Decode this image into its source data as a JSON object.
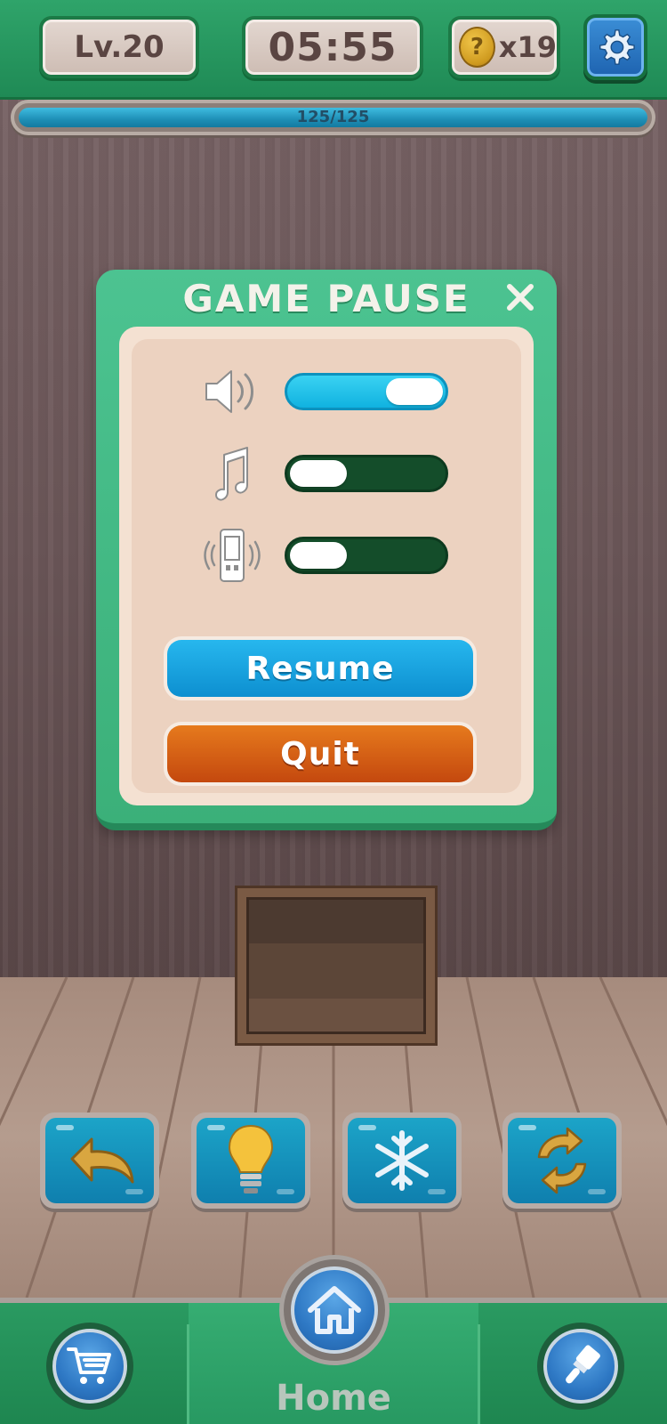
{
  "header": {
    "level": "Lv.20",
    "timer": "05:55",
    "coin_symbol": "?",
    "coins": "x19",
    "settings_icon": "gear-icon"
  },
  "progress": {
    "text": "125/125",
    "current": 125,
    "max": 125,
    "fill_color": "#1e8fb6"
  },
  "pause_dialog": {
    "title": "GAME PAUSE",
    "close_icon": "close-icon",
    "settings": [
      {
        "icon": "speaker-icon",
        "enabled": true
      },
      {
        "icon": "music-note-icon",
        "enabled": false
      },
      {
        "icon": "vibration-icon",
        "enabled": false
      }
    ],
    "resume_label": "Resume",
    "quit_label": "Quit"
  },
  "tools": [
    {
      "icon": "undo-arrow-icon"
    },
    {
      "icon": "lightbulb-icon"
    },
    {
      "icon": "snowflake-icon"
    },
    {
      "icon": "shuffle-icon"
    }
  ],
  "bottom_nav": {
    "home_label": "Home",
    "left_icon": "cart-icon",
    "center_icon": "home-icon",
    "right_icon": "paintbrush-icon"
  },
  "colors": {
    "brand_green": "#2fa46a",
    "toggle_on": "#10b2e0",
    "toggle_off": "#144d2a",
    "resume": "#0d8fd0",
    "quit": "#c4480e"
  }
}
